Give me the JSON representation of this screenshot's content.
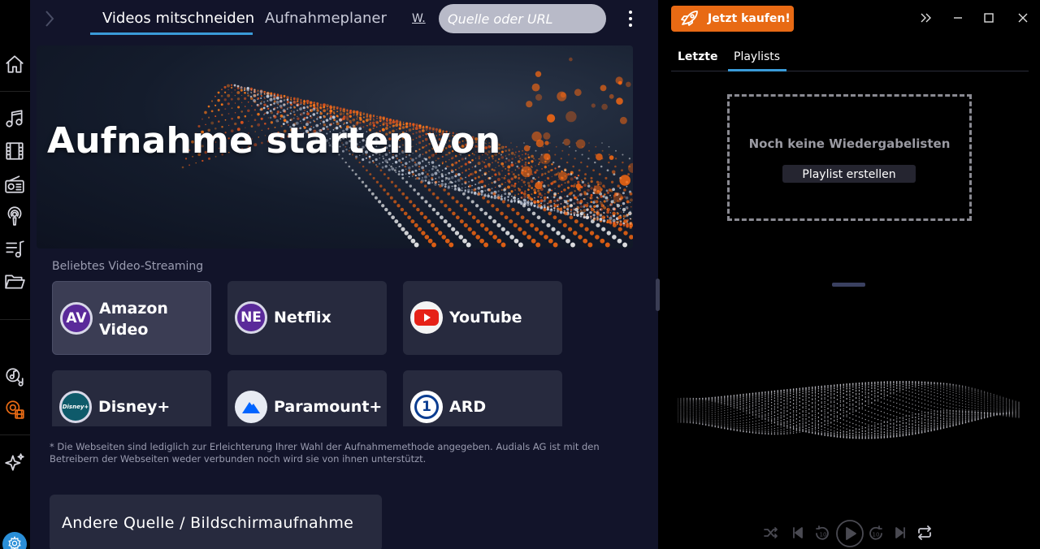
{
  "topbar": {
    "tabs": [
      {
        "label": "Videos mitschneiden",
        "active": true
      },
      {
        "label": "Aufnahmeplaner",
        "active": false
      }
    ],
    "overflow_tab": "W.",
    "search_placeholder": "Quelle oder URL"
  },
  "hero": {
    "title": "Aufnahme starten von"
  },
  "streaming": {
    "section_label": "Beliebtes Video-Streaming",
    "services": [
      {
        "name": "Amazon Video",
        "logo_text": "AV",
        "selected": true
      },
      {
        "name": "Netflix",
        "logo_text": "NE",
        "selected": false
      },
      {
        "name": "YouTube",
        "logo_text": "",
        "selected": false
      },
      {
        "name": "Disney+",
        "logo_text": "Disney+",
        "selected": false
      },
      {
        "name": "Paramount+",
        "logo_text": "",
        "selected": false
      },
      {
        "name": "ARD",
        "logo_text": "1",
        "selected": false
      }
    ]
  },
  "disclaimer": "* Die Webseiten sind lediglich zur Erleichterung Ihrer Wahl der Aufnahmemethode angegeben. Audials AG ist mit den Betreibern der Webseiten weder verbunden noch wird sie von ihnen unterstützt.",
  "other_source_label": "Andere Quelle / Bildschirmaufnahme",
  "right_panel": {
    "buy_label": "Jetzt kaufen!",
    "tabs": [
      {
        "label": "Letzte",
        "active": false
      },
      {
        "label": "Playlists",
        "active": true
      }
    ],
    "empty_title": "Noch keine Wiedergabelisten",
    "create_playlist_label": "Playlist erstellen"
  },
  "colors": {
    "accent_blue": "#3a9bd8",
    "buy_orange": "#e86a14",
    "panel_bg": "#12142a",
    "card_bg": "#272a3e"
  },
  "icons": {
    "rail": [
      "home-icon",
      "music-note-icon",
      "film-icon",
      "radio-icon",
      "podcast-icon",
      "playlist-icon",
      "folder-icon",
      "music-search-icon",
      "video-record-icon",
      "sparkle-icon",
      "settings-icon"
    ],
    "player": [
      "shuffle-icon",
      "skip-back-icon",
      "rewind-10-icon",
      "play-icon",
      "forward-10-icon",
      "skip-forward-icon",
      "repeat-icon"
    ]
  }
}
